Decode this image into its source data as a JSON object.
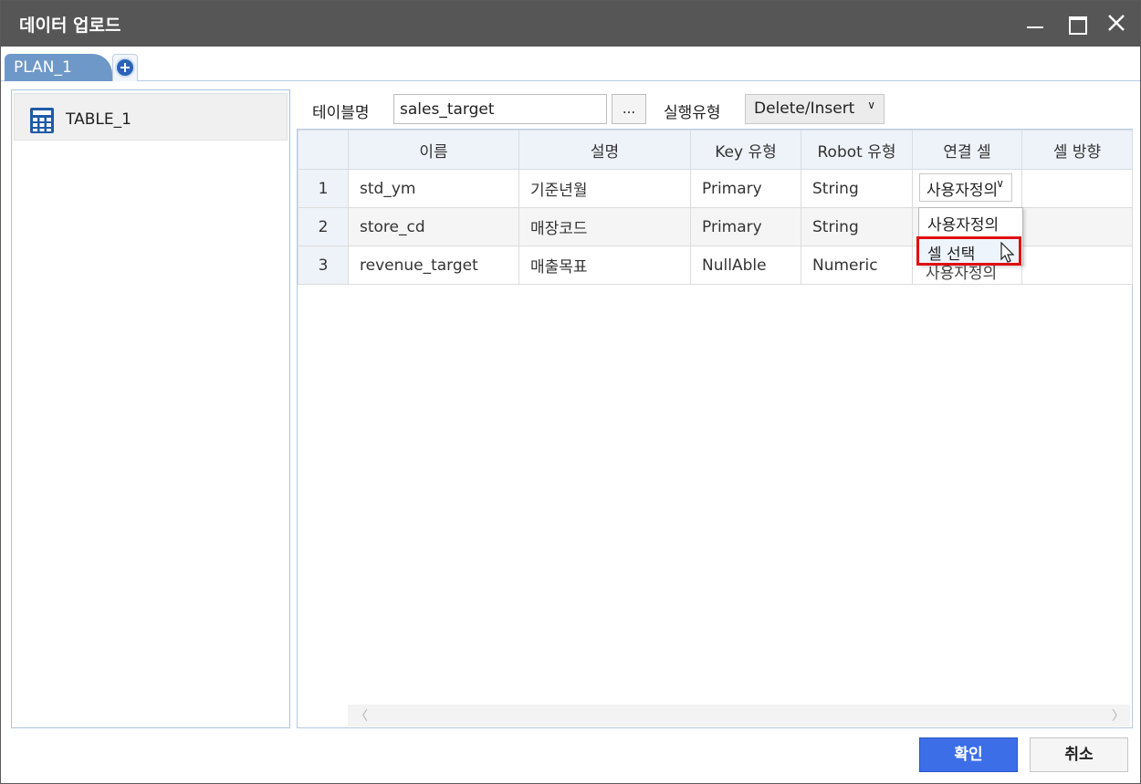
{
  "window": {
    "title": "데이터 업로드"
  },
  "tabs": [
    {
      "label": "PLAN_1"
    }
  ],
  "tree": {
    "items": [
      {
        "label": "TABLE_1"
      }
    ]
  },
  "form": {
    "table_name_label": "테이블명",
    "table_name_value": "sales_target",
    "browse_label": "...",
    "exec_type_label": "실행유형",
    "exec_type_value": "Delete/Insert"
  },
  "grid": {
    "columns": [
      "이름",
      "설명",
      "Key 유형",
      "Robot 유형",
      "연결 셀",
      "셀 방향"
    ],
    "rows": [
      {
        "num": "1",
        "name": "std_ym",
        "desc": "기준년월",
        "key": "Primary",
        "robot": "String",
        "link": "사용자정의",
        "dir": ""
      },
      {
        "num": "2",
        "name": "store_cd",
        "desc": "매장코드",
        "key": "Primary",
        "robot": "String",
        "link": "",
        "dir": ""
      },
      {
        "num": "3",
        "name": "revenue_target",
        "desc": "매출목표",
        "key": "NullAble",
        "robot": "Numeric",
        "link": "사용자정의",
        "dir": ""
      }
    ],
    "dropdown_options": [
      "사용자정의",
      "셀 선택"
    ]
  },
  "buttons": {
    "ok": "확인",
    "cancel": "취소"
  },
  "colors": {
    "titlebar": "#565656",
    "tab": "#6e98c8",
    "ok_button": "#3c6ee8",
    "highlight_border": "#e01010"
  }
}
